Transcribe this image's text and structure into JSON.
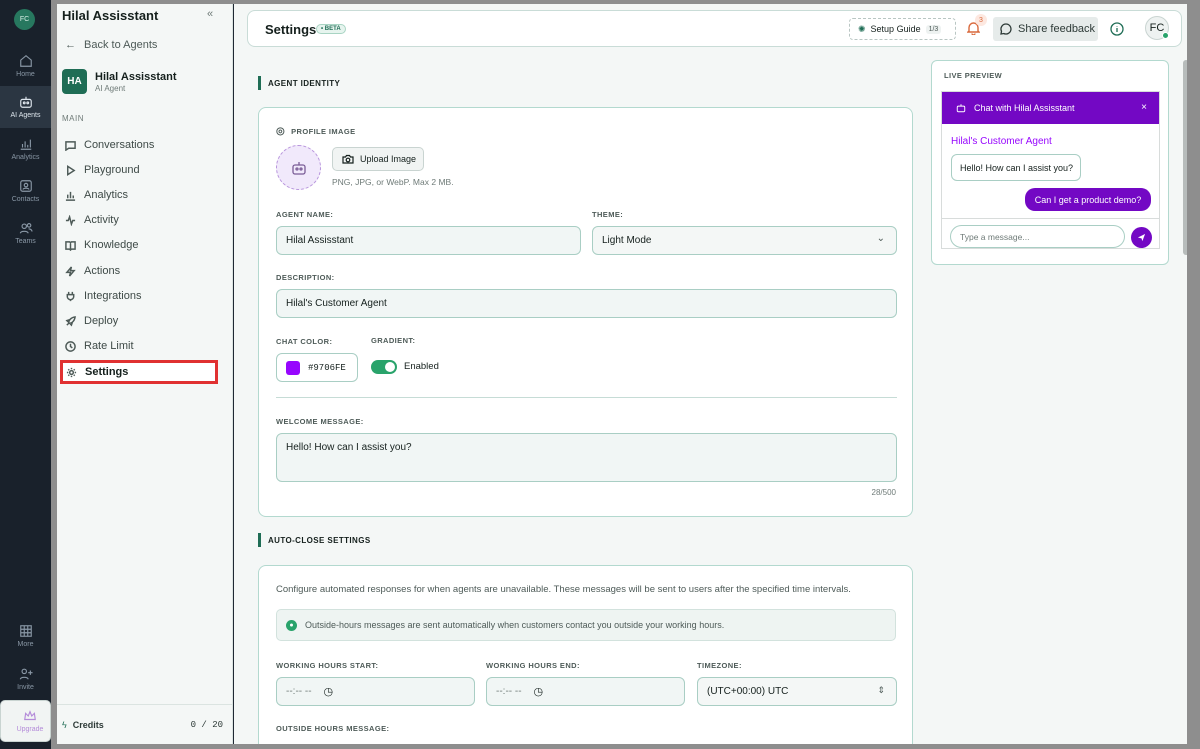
{
  "rail": {
    "logo": "FC",
    "items": [
      {
        "label": "Home",
        "icon": "home-icon"
      },
      {
        "label": "AI Agents",
        "icon": "bot-icon"
      },
      {
        "label": "Analytics",
        "icon": "chart-icon"
      },
      {
        "label": "Contacts",
        "icon": "contacts-icon"
      },
      {
        "label": "Teams",
        "icon": "teams-icon"
      },
      {
        "label": "More",
        "icon": "grid-icon"
      },
      {
        "label": "Invite",
        "icon": "invite-icon"
      },
      {
        "label": "Upgrade",
        "icon": "crown-icon"
      }
    ]
  },
  "sidebar": {
    "title": "Hilal Assisstant",
    "back": "Back to Agents",
    "agent_initials": "HA",
    "agent_name": "Hilal Assisstant",
    "agent_sub": "AI Agent",
    "section": "MAIN",
    "items": [
      {
        "label": "Conversations"
      },
      {
        "label": "Playground"
      },
      {
        "label": "Analytics"
      },
      {
        "label": "Activity"
      },
      {
        "label": "Knowledge"
      },
      {
        "label": "Actions"
      },
      {
        "label": "Integrations"
      },
      {
        "label": "Deploy"
      },
      {
        "label": "Rate Limit"
      },
      {
        "label": "Settings"
      }
    ],
    "credits_label": "Credits",
    "credits_value": "0 / 20"
  },
  "header": {
    "title": "Settings",
    "badge": "• BETA",
    "setup_guide": "Setup Guide",
    "setup_count": "1/3",
    "notifications": "3",
    "share_feedback": "Share feedback",
    "user_initials": "FC"
  },
  "identity": {
    "section_title": "AGENT IDENTITY",
    "profile_label": "PROFILE IMAGE",
    "upload_label": "Upload Image",
    "upload_hint": "PNG, JPG, or WebP. Max 2 MB.",
    "name_label": "AGENT NAME:",
    "name_value": "Hilal Assisstant",
    "theme_label": "THEME:",
    "theme_value": "Light Mode",
    "desc_label": "DESCRIPTION:",
    "desc_value": "Hilal's Customer Agent",
    "color_label": "CHAT COLOR:",
    "color_value": "#9706FE",
    "gradient_label": "GRADIENT:",
    "gradient_value": "Enabled",
    "welcome_label": "WELCOME MESSAGE:",
    "welcome_value": "Hello! How can I assist you?",
    "welcome_count": "28/500"
  },
  "autoclose": {
    "section_title": "AUTO-CLOSE SETTINGS",
    "description": "Configure automated responses for when agents are unavailable. These messages will be sent to users after the specified time intervals.",
    "info": "Outside-hours messages are sent automatically when customers contact you outside your working hours.",
    "start_label": "WORKING HOURS START:",
    "start_value": "--:-- --",
    "end_label": "WORKING HOURS END:",
    "end_value": "--:-- --",
    "tz_label": "TIMEZONE:",
    "tz_value": "(UTC+00:00) UTC",
    "outside_label": "OUTSIDE HOURS MESSAGE:"
  },
  "preview": {
    "label": "LIVE PREVIEW",
    "chat_title": "Chat with Hilal Assisstant",
    "agent_line": "Hilal's Customer Agent",
    "bot_msg": "Hello! How can I assist you?",
    "user_msg": "Can I get a product demo?",
    "input_placeholder": "Type a message...",
    "accent": "#7308c4"
  }
}
